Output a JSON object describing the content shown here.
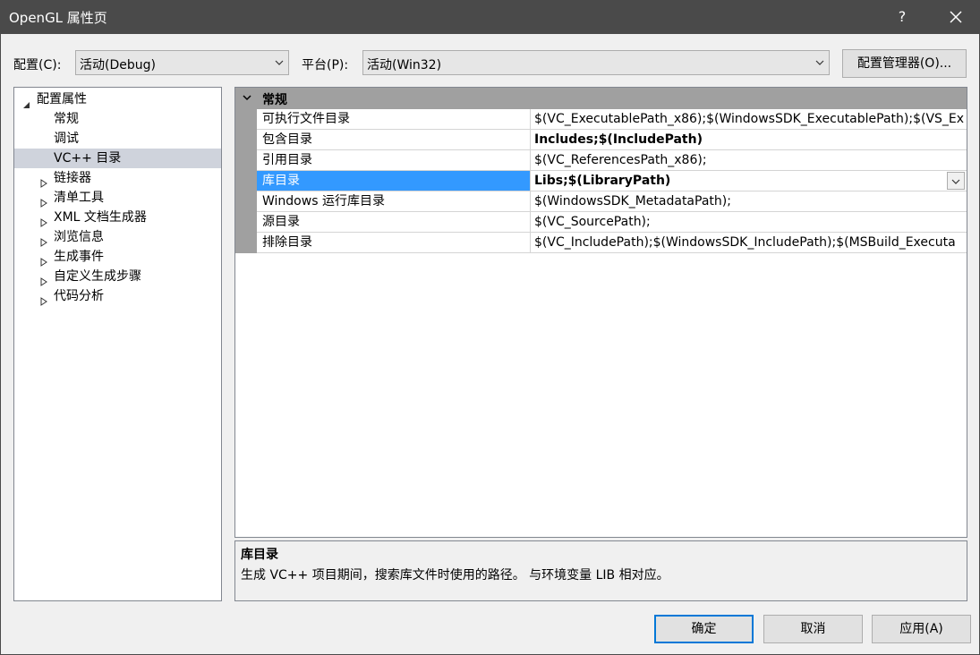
{
  "window": {
    "title": "OpenGL 属性页",
    "help": "?"
  },
  "config": {
    "label": "配置(C):",
    "value": "活动(Debug)",
    "platform_label": "平台(P):",
    "platform_value": "活动(Win32)",
    "manager_button": "配置管理器(O)..."
  },
  "tree": {
    "root": "配置属性",
    "items": [
      {
        "label": "常规",
        "selected": false,
        "expandable": false
      },
      {
        "label": "调试",
        "selected": false,
        "expandable": false
      },
      {
        "label": "VC++ 目录",
        "selected": true,
        "expandable": false
      },
      {
        "label": "链接器",
        "selected": false,
        "expandable": true
      },
      {
        "label": "清单工具",
        "selected": false,
        "expandable": true
      },
      {
        "label": "XML 文档生成器",
        "selected": false,
        "expandable": true
      },
      {
        "label": "浏览信息",
        "selected": false,
        "expandable": true
      },
      {
        "label": "生成事件",
        "selected": false,
        "expandable": true
      },
      {
        "label": "自定义生成步骤",
        "selected": false,
        "expandable": true
      },
      {
        "label": "代码分析",
        "selected": false,
        "expandable": true
      }
    ]
  },
  "grid": {
    "section": "常规",
    "rows": [
      {
        "name": "可执行文件目录",
        "value": "$(VC_ExecutablePath_x86);$(WindowsSDK_ExecutablePath);$(VS_Ex",
        "bold": false,
        "selected": false
      },
      {
        "name": "包含目录",
        "value": "Includes;$(IncludePath)",
        "bold": true,
        "selected": false
      },
      {
        "name": "引用目录",
        "value": "$(VC_ReferencesPath_x86);",
        "bold": false,
        "selected": false
      },
      {
        "name": "库目录",
        "value": "Libs;$(LibraryPath)",
        "bold": true,
        "selected": true
      },
      {
        "name": "Windows 运行库目录",
        "value": "$(WindowsSDK_MetadataPath);",
        "bold": false,
        "selected": false
      },
      {
        "name": "源目录",
        "value": "$(VC_SourcePath);",
        "bold": false,
        "selected": false
      },
      {
        "name": "排除目录",
        "value": "$(VC_IncludePath);$(WindowsSDK_IncludePath);$(MSBuild_Executa",
        "bold": false,
        "selected": false
      }
    ]
  },
  "description": {
    "title": "库目录",
    "text": "生成 VC++ 项目期间，搜索库文件时使用的路径。 与环境变量 LIB 相对应。"
  },
  "buttons": {
    "ok": "确定",
    "cancel": "取消",
    "apply": "应用(A)"
  }
}
